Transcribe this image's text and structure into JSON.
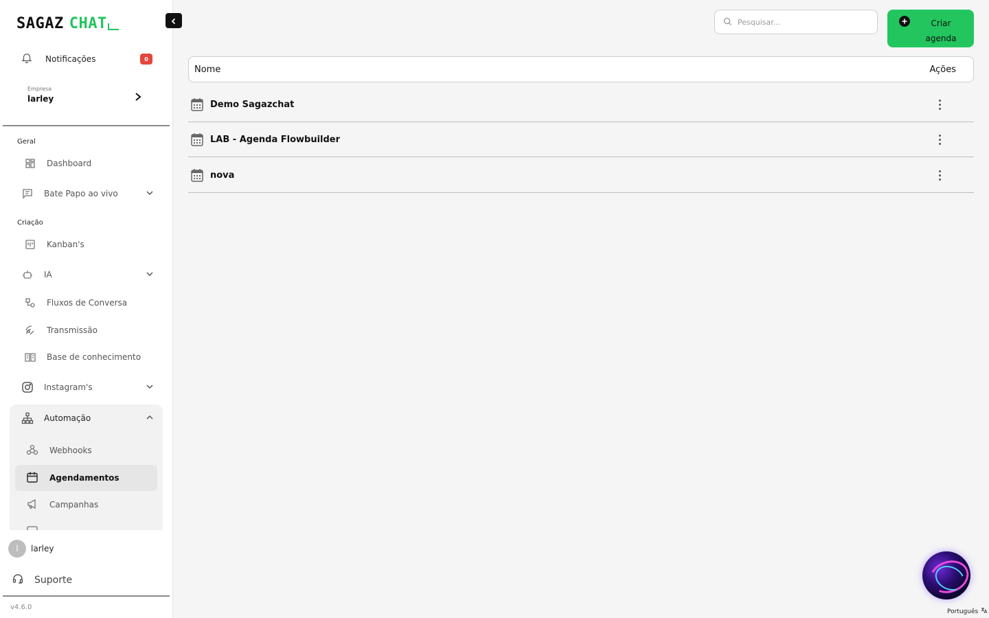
{
  "brand": {
    "name_a": "SAGAZ",
    "name_b": "CHAT"
  },
  "notifications": {
    "label": "Notificações",
    "count": "0"
  },
  "company": {
    "small_label": "Empresa",
    "name": "larley"
  },
  "sections": {
    "geral": "Geral",
    "criacao": "Criação"
  },
  "nav": {
    "dashboard": "Dashboard",
    "bate_papo": "Bate Papo ao vivo",
    "kanban": "Kanban's",
    "ia": "IA",
    "fluxos": "Fluxos de Conversa",
    "transmissao": "Transmissão",
    "base": "Base de conhecimento",
    "instagram": "Instagram's",
    "automacao": "Automação",
    "webhooks": "Webhooks",
    "agendamentos": "Agendamentos",
    "campanhas": "Campanhas"
  },
  "user": {
    "initial": "l",
    "name": "larley"
  },
  "support": {
    "label": "Suporte"
  },
  "version": "v4.6.0",
  "search": {
    "placeholder": "Pesquisar..."
  },
  "create_button": {
    "line1": "Criar",
    "line2": "agenda"
  },
  "table": {
    "headers": {
      "name": "Nome",
      "actions": "Ações"
    },
    "rows": [
      {
        "name": "Demo Sagazchat"
      },
      {
        "name": "LAB - Agenda Flowbuilder"
      },
      {
        "name": "nova"
      }
    ]
  },
  "language": {
    "label": "Português"
  },
  "colors": {
    "accent": "#22c55e",
    "badge": "#e5453b"
  }
}
